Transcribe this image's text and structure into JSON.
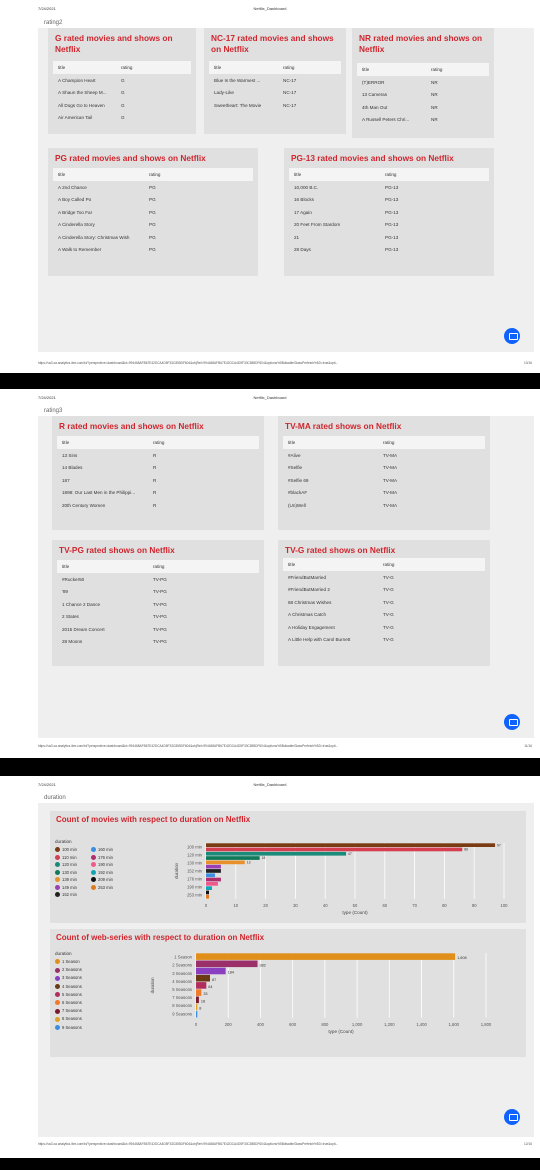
{
  "header": {
    "date": "7/24/2021",
    "title": "Netflix_Dashboard"
  },
  "url": "https://us3.ca.analytics.ibm.com/bi/?perspective=dashboard&id=994468AFB67E42DCA4D5F33C855DF604&objRef=994468AFB67E42DCA4D5F33C855DF604&options%5BdisableGlassPrefetch%5D=true&opti...",
  "page1": {
    "label": "rating2",
    "page_number": "10/16",
    "cards": [
      {
        "title": "G rated movies and shows on Netflix",
        "col_title": "title",
        "col_rating": "rating",
        "rows": [
          [
            "A Champion Heart",
            "G"
          ],
          [
            "A Shaun the Sheep M...",
            "G"
          ],
          [
            "All Dogs Go to Heaven",
            "G"
          ],
          [
            "Air American Tail",
            "G"
          ]
        ]
      },
      {
        "title": "NC-17 rated movies and shows on Netflix",
        "col_title": "title",
        "col_rating": "rating",
        "rows": [
          [
            "Blue Is the Warmest ...",
            "NC-17"
          ],
          [
            "Lady-Like",
            "NC-17"
          ],
          [
            "Sweetheart: The Movie",
            "NC-17"
          ]
        ]
      },
      {
        "title": "NR rated movies and shows on Netflix",
        "col_title": "title",
        "col_rating": "rating",
        "rows": [
          [
            "(T)ERROR",
            "NR"
          ],
          [
            "13 Cameras",
            "NR"
          ],
          [
            "4th Man Out",
            "NR"
          ],
          [
            "A Russell Peters Chri...",
            "NR"
          ]
        ]
      },
      {
        "title": "PG rated movies and shows on Netflix",
        "col_title": "title",
        "col_rating": "rating",
        "rows": [
          [
            "A 2nd Chance",
            "PG"
          ],
          [
            "A Boy Called Po",
            "PG"
          ],
          [
            "A Bridge Too Far",
            "PG"
          ],
          [
            "A Cinderella Story",
            "PG"
          ],
          [
            "A Cinderella Story: Christmas Wish",
            "PG"
          ],
          [
            "A Walk to Remember",
            "PG"
          ]
        ]
      },
      {
        "title": "PG-13 rated movies and shows on Netflix",
        "col_title": "title",
        "col_rating": "rating",
        "rows": [
          [
            "10,000 B.C.",
            "PG-13"
          ],
          [
            "16 Blocks",
            "PG-13"
          ],
          [
            "17 Again",
            "PG-13"
          ],
          [
            "20 Feet From Stardom",
            "PG-13"
          ],
          [
            "21",
            "PG-13"
          ],
          [
            "28 Days",
            "PG-13"
          ]
        ]
      }
    ]
  },
  "page2": {
    "label": "rating3",
    "page_number": "11/16",
    "cards": [
      {
        "title": "R rated movies and shows on Netflix",
        "col_title": "title",
        "col_rating": "rating",
        "rows": [
          [
            "13 Sins",
            "R"
          ],
          [
            "14 Blades",
            "R"
          ],
          [
            "187",
            "R"
          ],
          [
            "1898: Our Last Men in the Philippi...",
            "R"
          ],
          [
            "20th Century Women",
            "R"
          ]
        ]
      },
      {
        "title": "TV-MA rated shows on Netflix",
        "col_title": "title",
        "col_rating": "rating",
        "rows": [
          [
            "#Alive",
            "TV-MA"
          ],
          [
            "#Selfie",
            "TV-MA"
          ],
          [
            "#Selfie 69",
            "TV-MA"
          ],
          [
            "#blackAF",
            "TV-MA"
          ],
          [
            "(Un)Well",
            "TV-MA"
          ]
        ]
      },
      {
        "title": "TV-PG rated shows on Netflix",
        "col_title": "title",
        "col_rating": "rating",
        "rows": [
          [
            "#Rucker50",
            "TV-PG"
          ],
          [
            "'89",
            "TV-PG"
          ],
          [
            "1 Chance 2 Dance",
            "TV-PG"
          ],
          [
            "2 States",
            "TV-PG"
          ],
          [
            "2015 Dream Concert",
            "TV-PG"
          ],
          [
            "28 Moons",
            "TV-PG"
          ]
        ]
      },
      {
        "title": "TV-G rated shows on Netflix",
        "col_title": "title",
        "col_rating": "rating",
        "rows": [
          [
            "#FriendButMarried",
            "TV-G"
          ],
          [
            "#FriendButMarried 2",
            "TV-G"
          ],
          [
            "68 Christmas Wishes",
            "TV-G"
          ],
          [
            "A Christmas Catch",
            "TV-G"
          ],
          [
            "A Holiday Engagement",
            "TV-G"
          ],
          [
            "A Little Help with Carol Burnett",
            "TV-G"
          ]
        ]
      }
    ]
  },
  "page3": {
    "label": "duration",
    "page_number": "12/16",
    "movies_legend": [
      {
        "label": "100 min",
        "color": "#7a3b13"
      },
      {
        "label": "110 min",
        "color": "#d43e4f"
      },
      {
        "label": "120 min",
        "color": "#1a8a7a"
      },
      {
        "label": "130 min",
        "color": "#0f7a5a"
      },
      {
        "label": "139 min",
        "color": "#e8902a"
      },
      {
        "label": "149 min",
        "color": "#9b3fb5"
      },
      {
        "label": "152 min",
        "color": "#222222"
      },
      {
        "label": "160 min",
        "color": "#3a8fe0"
      },
      {
        "label": "176 min",
        "color": "#b02d6e"
      },
      {
        "label": "190 min",
        "color": "#ef5a8a"
      },
      {
        "label": "192 min",
        "color": "#14a5b5"
      },
      {
        "label": "209 min",
        "color": "#111111"
      },
      {
        "label": "253 min",
        "color": "#e07a1c"
      }
    ],
    "series_legend": [
      {
        "label": "1 Season",
        "color": "#e0901a"
      },
      {
        "label": "2 Seasons",
        "color": "#9b2f6a"
      },
      {
        "label": "3 Seasons",
        "color": "#8a3fc0"
      },
      {
        "label": "4 Seasons",
        "color": "#6a3a14"
      },
      {
        "label": "5 Seasons",
        "color": "#b02d5e"
      },
      {
        "label": "6 Seasons",
        "color": "#ef7a2a"
      },
      {
        "label": "7 Seasons",
        "color": "#7a1a2a"
      },
      {
        "label": "8 Seasons",
        "color": "#e0a020"
      },
      {
        "label": "9 Seasons",
        "color": "#3a8fe0"
      }
    ]
  },
  "chart_data": [
    {
      "type": "bar",
      "title": "Count of movies with respect to duration on Netflix",
      "legend_title": "duration",
      "xlabel": "type (Count)",
      "ylabel": "duration",
      "orientation": "horizontal",
      "grid": true,
      "xlim": [
        0,
        100
      ],
      "xticks": [
        "0",
        "10",
        "20",
        "30",
        "40",
        "50",
        "60",
        "70",
        "80",
        "90",
        "100"
      ],
      "categories": [
        "100 min",
        "110 min",
        "120 min",
        "130 min",
        "139 min",
        "149 min",
        "152 min",
        "160 min",
        "176 min",
        "190 min",
        "192 min",
        "209 min",
        "253 min"
      ],
      "values": [
        97,
        86,
        47,
        18,
        13,
        5,
        5,
        3,
        5,
        4,
        2,
        1,
        1
      ],
      "value_labels": [
        "97",
        "86",
        "47",
        "18",
        "13",
        "",
        "",
        "",
        "",
        "",
        "",
        "",
        ""
      ],
      "colors": [
        "#7a3b13",
        "#d43e4f",
        "#1a8a7a",
        "#0f7a5a",
        "#e8902a",
        "#9b3fb5",
        "#222222",
        "#3a8fe0",
        "#b02d6e",
        "#ef5a8a",
        "#14a5b5",
        "#111111",
        "#e07a1c"
      ],
      "yticks_shown": [
        "100 min",
        "120 min",
        "130 min",
        "152 min",
        "176 min",
        "190 min",
        "253 min"
      ]
    },
    {
      "type": "bar",
      "title": "Count of web-series with respect to duration on Netflix",
      "legend_title": "duration",
      "xlabel": "type (Count)",
      "ylabel": "duration",
      "orientation": "horizontal",
      "grid": true,
      "xlim": [
        0,
        1800
      ],
      "xticks": [
        "0",
        "200",
        "400",
        "600",
        "800",
        "1,000",
        "1,200",
        "1,400",
        "1,600",
        "1,800"
      ],
      "categories": [
        "1 Season",
        "2 Seasons",
        "3 Seasons",
        "4 Seasons",
        "5 Seasons",
        "6 Seasons",
        "7 Seasons",
        "8 Seasons",
        "9 Seasons"
      ],
      "values": [
        1608,
        382,
        184,
        87,
        64,
        33,
        18,
        8,
        8
      ],
      "value_labels": [
        "1,608",
        "382",
        "184",
        "87",
        "64",
        "33",
        "18",
        "8",
        ""
      ],
      "colors": [
        "#e0901a",
        "#9b2f6a",
        "#8a3fc0",
        "#6a3a14",
        "#b02d5e",
        "#ef7a2a",
        "#7a1a2a",
        "#e0a020",
        "#3a8fe0"
      ],
      "yticks_shown": [
        "1 Season",
        "2 Seasons",
        "3 Seasons",
        "4 Seasons",
        "5 Seasons",
        "7 Seasons",
        "8 Seasons",
        "9 Seasons"
      ]
    }
  ]
}
